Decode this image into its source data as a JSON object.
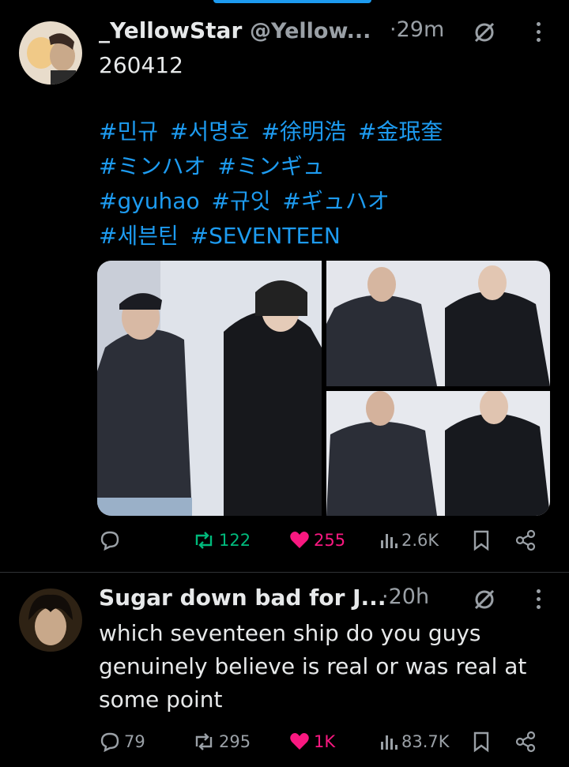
{
  "tweet1": {
    "name": "_YellowStar",
    "handle": "@Yellow...",
    "time": "·29m",
    "text": "260412",
    "hashtags": [
      [
        "#민규",
        "#서명호",
        "#徐明浩",
        "#金珉奎"
      ],
      [
        "#ミンハオ",
        "#ミンギュ"
      ],
      [
        "#gyuhao",
        "#규잇",
        "#ギュハオ"
      ],
      [
        "#세븐틴",
        "#SEVENTEEN"
      ]
    ],
    "replies": "",
    "reposts": "122",
    "likes": "255",
    "views": "2.6K"
  },
  "tweet2": {
    "name": "Sugar down bad for J...",
    "time": "·20h",
    "text_lines": [
      "which seventeen ship do you guys",
      "genuinely believe is real or was real at",
      "some point"
    ],
    "replies": "79",
    "reposts": "295",
    "likes": "1K",
    "views": "83.7K"
  },
  "colors": {
    "background": "#000000",
    "text": "#e7e9ea",
    "muted": "#9aa0a6",
    "link": "#1d9bf0",
    "repost_active": "#00ba7c",
    "like_active": "#f91880"
  },
  "icons": [
    "mute-icon",
    "more-icon",
    "reply-icon",
    "repost-icon",
    "like-icon",
    "views-icon",
    "bookmark-icon",
    "share-icon"
  ]
}
